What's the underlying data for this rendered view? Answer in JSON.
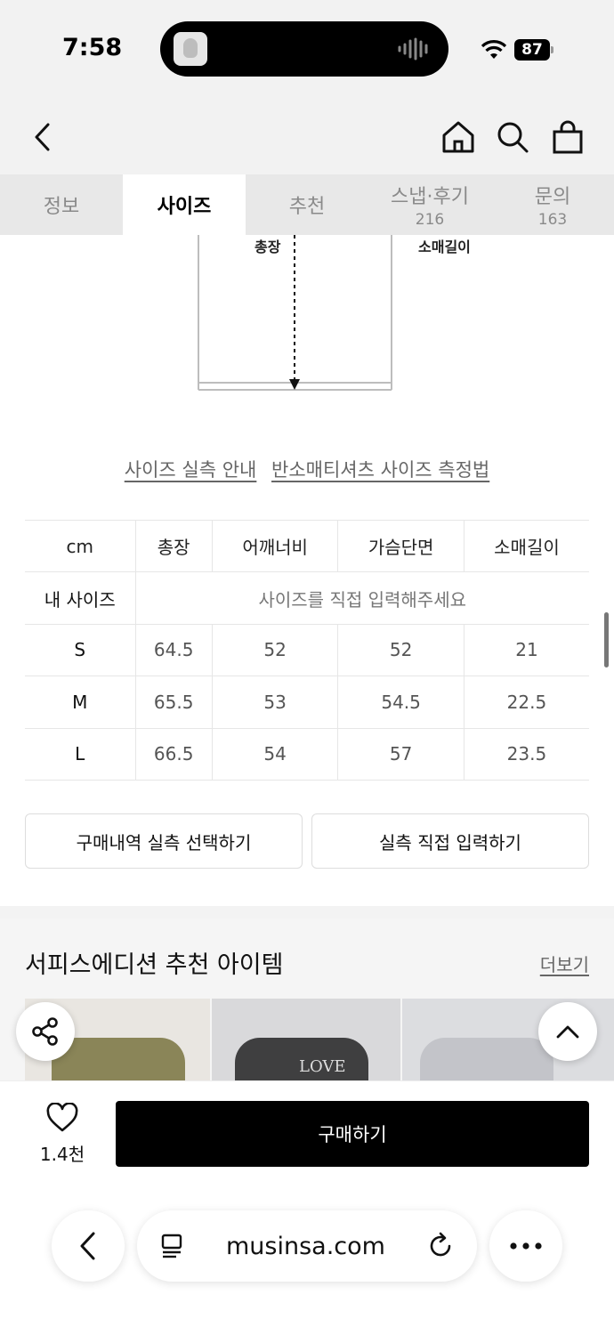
{
  "status_bar": {
    "time": "7:58",
    "battery": "87"
  },
  "tabs": [
    {
      "label": "정보",
      "count": ""
    },
    {
      "label": "사이즈",
      "count": ""
    },
    {
      "label": "추천",
      "count": ""
    },
    {
      "label": "스냅·후기",
      "count": "216"
    },
    {
      "label": "문의",
      "count": "163"
    }
  ],
  "diagram": {
    "length_label": "총장",
    "sleeve_label": "소매길이"
  },
  "links": {
    "guide": "사이즈 실측 안내",
    "method": "반소매티셔츠 사이즈 측정법"
  },
  "size_table": {
    "headers": [
      "cm",
      "총장",
      "어깨너비",
      "가슴단면",
      "소매길이"
    ],
    "my_size_label": "내 사이즈",
    "my_size_hint": "사이즈를 직접 입력해주세요",
    "rows": [
      {
        "size": "S",
        "values": [
          "64.5",
          "52",
          "52",
          "21"
        ]
      },
      {
        "size": "M",
        "values": [
          "65.5",
          "53",
          "54.5",
          "22.5"
        ]
      },
      {
        "size": "L",
        "values": [
          "66.5",
          "54",
          "57",
          "23.5"
        ]
      }
    ]
  },
  "actions": {
    "select_history": "구매내역 실측 선택하기",
    "enter_direct": "실측 직접 입력하기"
  },
  "recommend": {
    "title": "서피스에디션 추천 아이템",
    "more": "더보기",
    "shirt_print": "LOVE"
  },
  "bottom": {
    "like_count": "1.4천",
    "buy": "구매하기"
  },
  "browser": {
    "url": "musinsa.com"
  }
}
